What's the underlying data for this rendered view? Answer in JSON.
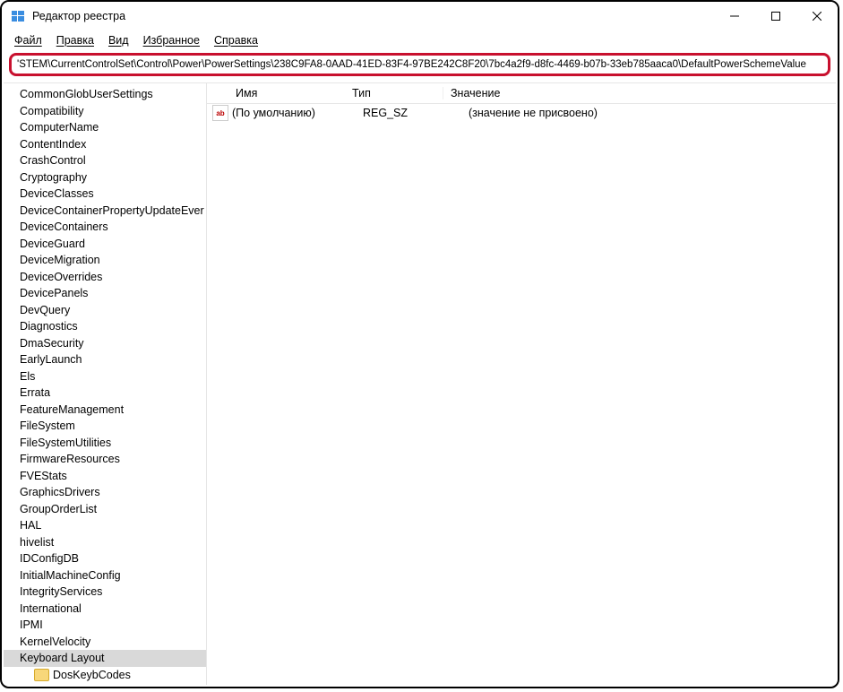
{
  "window": {
    "title": "Редактор реестра"
  },
  "menu": {
    "file": "Файл",
    "edit": "Правка",
    "view": "Вид",
    "favorites": "Избранное",
    "help": "Справка"
  },
  "address": "'STEM\\CurrentControlSet\\Control\\Power\\PowerSettings\\238C9FA8-0AAD-41ED-83F4-97BE242C8F20\\7bc4a2f9-d8fc-4469-b07b-33eb785aaca0\\DefaultPowerSchemeValue",
  "tree": {
    "items": [
      "CommonGlobUserSettings",
      "Compatibility",
      "ComputerName",
      "ContentIndex",
      "CrashControl",
      "Cryptography",
      "DeviceClasses",
      "DeviceContainerPropertyUpdateEver",
      "DeviceContainers",
      "DeviceGuard",
      "DeviceMigration",
      "DeviceOverrides",
      "DevicePanels",
      "DevQuery",
      "Diagnostics",
      "DmaSecurity",
      "EarlyLaunch",
      "Els",
      "Errata",
      "FeatureManagement",
      "FileSystem",
      "FileSystemUtilities",
      "FirmwareResources",
      "FVEStats",
      "GraphicsDrivers",
      "GroupOrderList",
      "HAL",
      "hivelist",
      "IDConfigDB",
      "InitialMachineConfig",
      "IntegrityServices",
      "International",
      "IPMI",
      "KernelVelocity",
      "Keyboard Layout"
    ],
    "selected": "Keyboard Layout",
    "sub": "DosKeybCodes"
  },
  "columns": {
    "name": "Имя",
    "type": "Тип",
    "value": "Значение"
  },
  "rows": [
    {
      "name": "(По умолчанию)",
      "type": "REG_SZ",
      "value": "(значение не присвоено)"
    }
  ]
}
